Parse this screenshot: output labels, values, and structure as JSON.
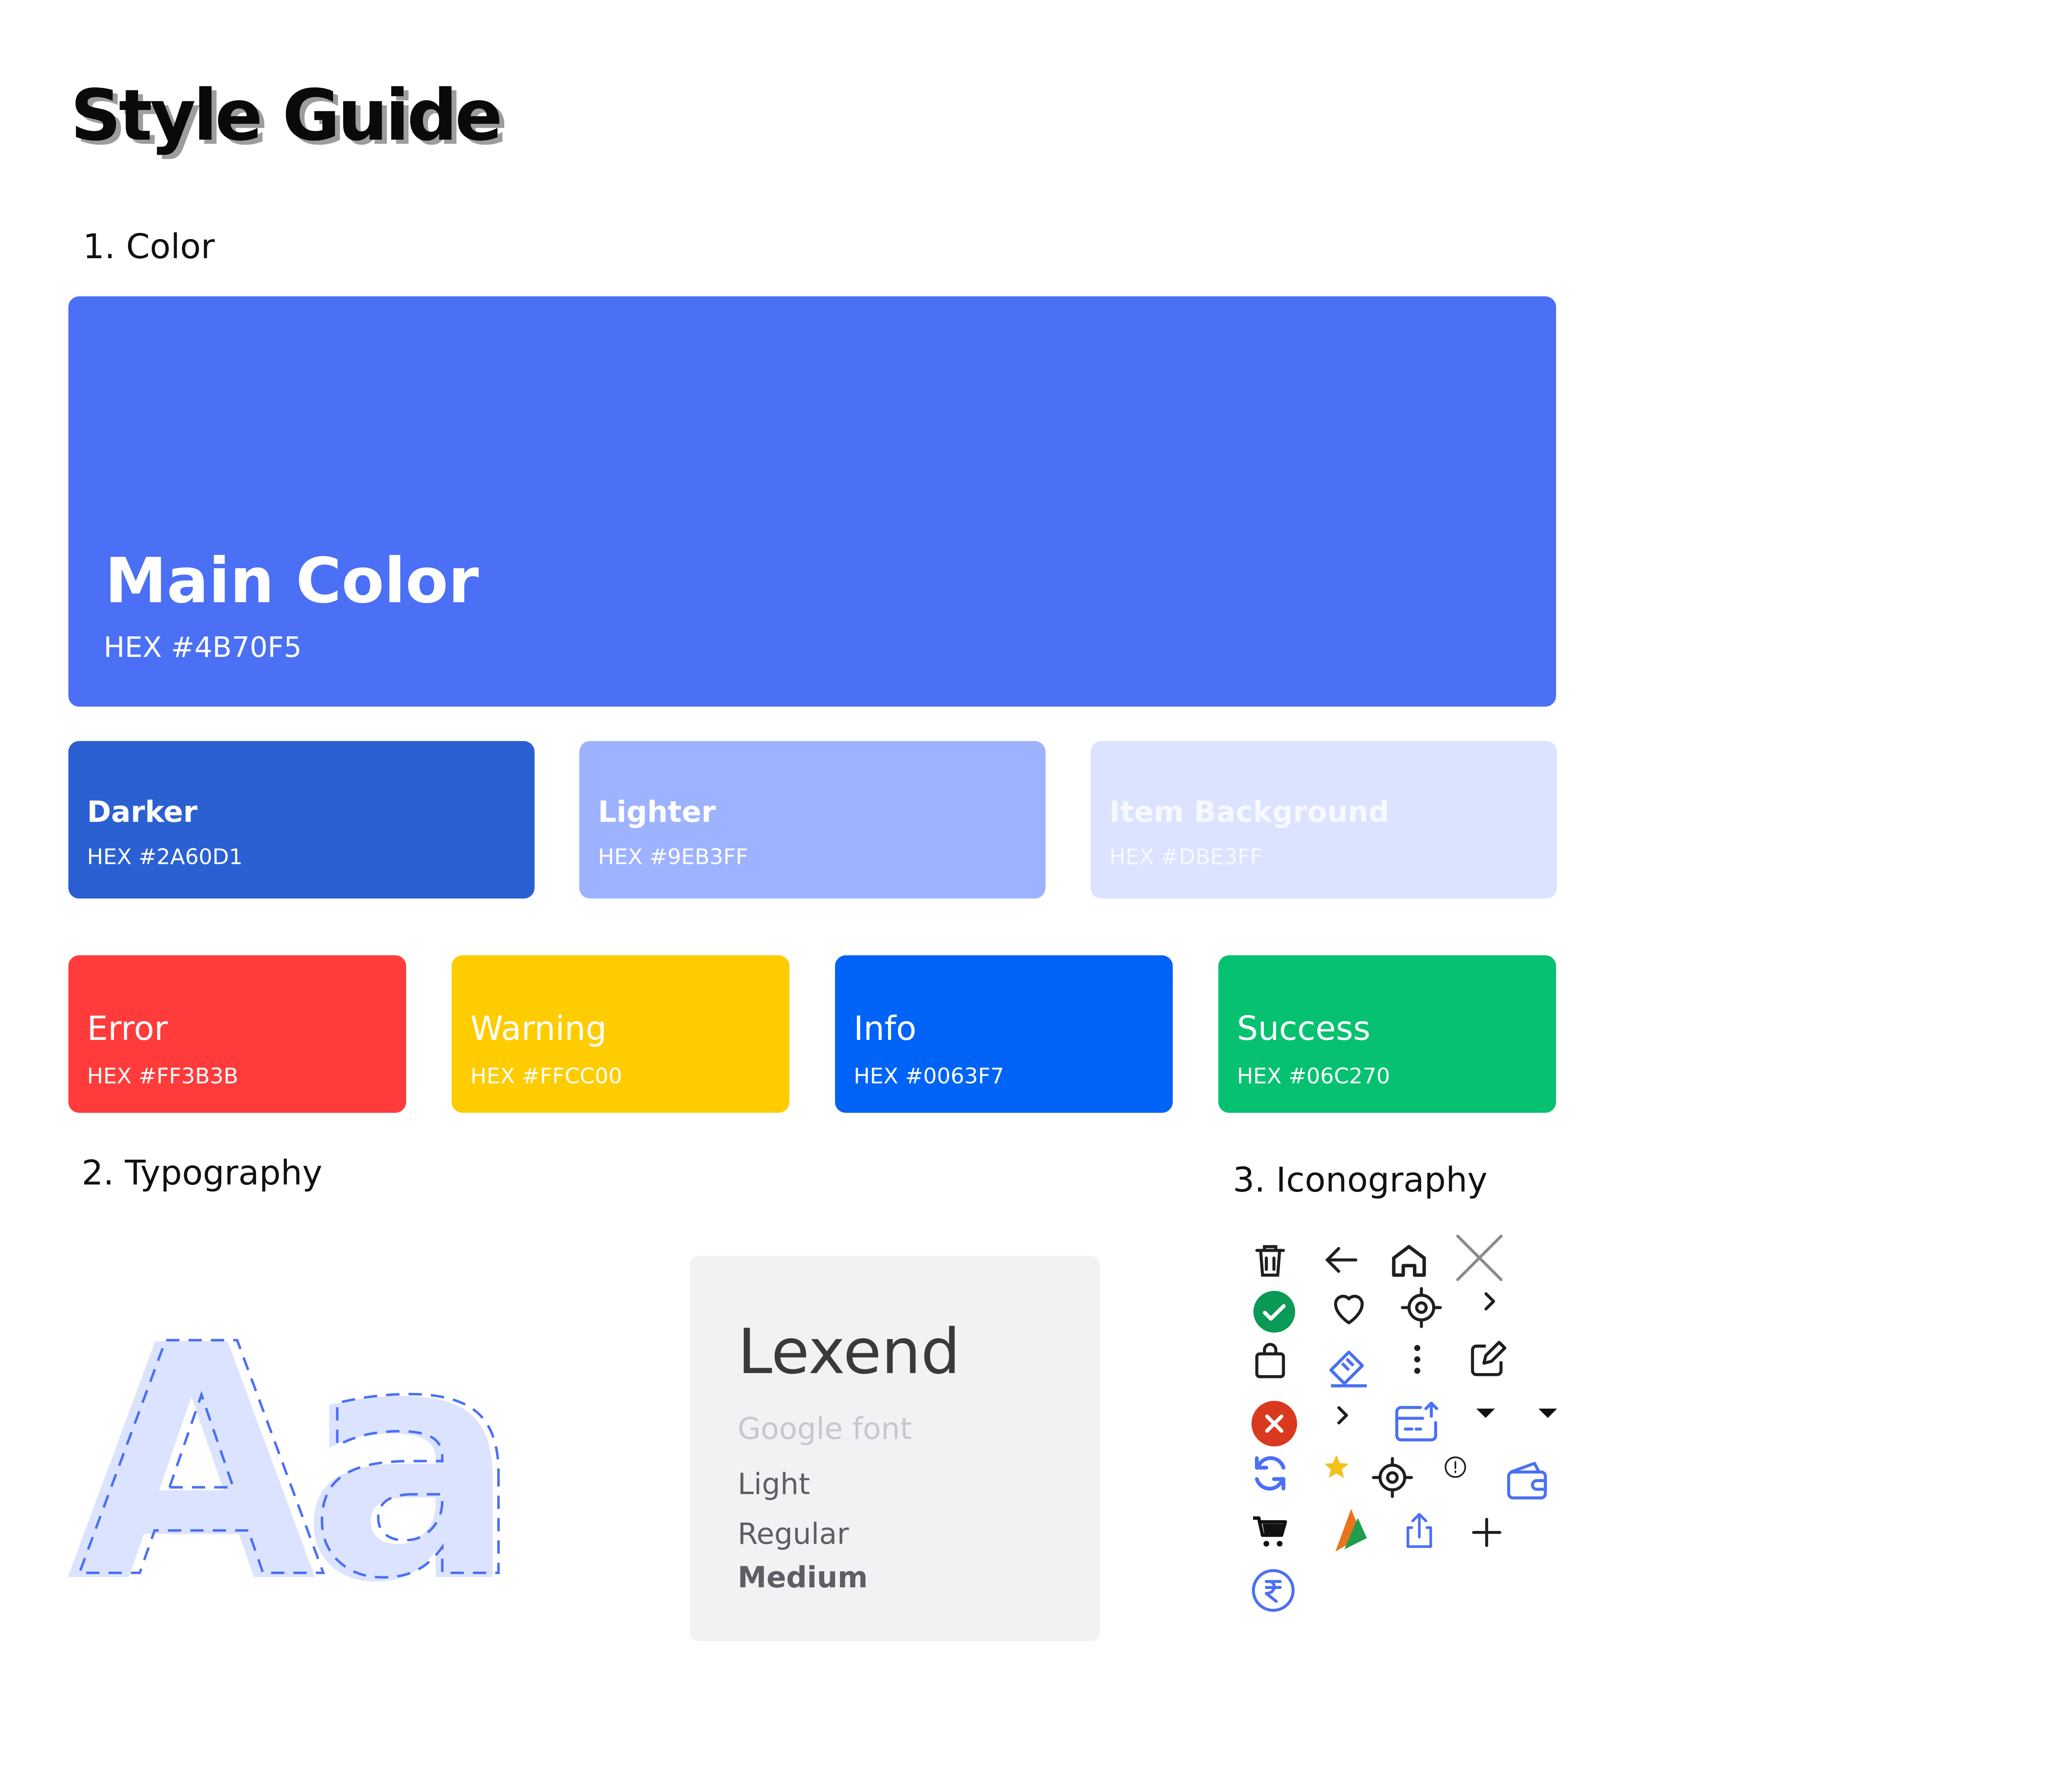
{
  "title": "Style Guide",
  "sections": {
    "color": "1. Color",
    "typography": "2. Typography",
    "iconography": "3. Iconography"
  },
  "colors": {
    "main": {
      "name": "Main Color",
      "hex_label": "HEX #4B70F5",
      "bg": "#4B70F5"
    },
    "darker": {
      "name": "Darker",
      "hex_label": "HEX #2A60D1",
      "bg": "#2A60D1"
    },
    "lighter": {
      "name": "Lighter",
      "hex_label": "HEX #9EB3FF",
      "bg": "#9EB3FF"
    },
    "item_background": {
      "name": "Item Background",
      "hex_label": "HEX #DBE3FF",
      "bg": "#DBE3FF"
    },
    "error": {
      "name": "Error",
      "hex_label": "HEX #FF3B3B",
      "bg": "#FF3B3B"
    },
    "warning": {
      "name": "Warning",
      "hex_label": "HEX #FFCC00",
      "bg": "#FFCC00"
    },
    "info": {
      "name": "Info",
      "hex_label": "HEX #0063F7",
      "bg": "#0063F7"
    },
    "success": {
      "name": "Success",
      "hex_label": "HEX #06C270",
      "bg": "#06C270"
    }
  },
  "typography": {
    "sample_glyphs": "Aa",
    "font_name": "Lexend",
    "font_source": "Google font",
    "weights": [
      "Light",
      "Regular",
      "Medium"
    ]
  },
  "icons": [
    "trash-icon",
    "arrow-left-icon",
    "home-icon",
    "close-large-icon",
    "check-circle-icon",
    "heart-icon",
    "locate-icon",
    "chevron-right-icon",
    "shopping-bag-icon",
    "coupon-icon",
    "more-vertical-icon",
    "edit-icon",
    "error-circle-icon",
    "chevron-right-icon",
    "card-upload-icon",
    "caret-down-icon",
    "caret-down-icon",
    "refresh-icon",
    "star-icon",
    "locate-icon",
    "info-circle-icon",
    "wallet-icon",
    "cart-icon",
    "bank-logo-icon",
    "share-icon",
    "plus-icon",
    "rupee-circle-icon"
  ],
  "icon_colors": {
    "dark": "#1f1f1f",
    "accent": "#4B70F5",
    "success": "#0B9A55",
    "error": "#D93A1F",
    "star": "#F2C21B",
    "orange": "#E8741E",
    "green": "#1E9E4A"
  }
}
